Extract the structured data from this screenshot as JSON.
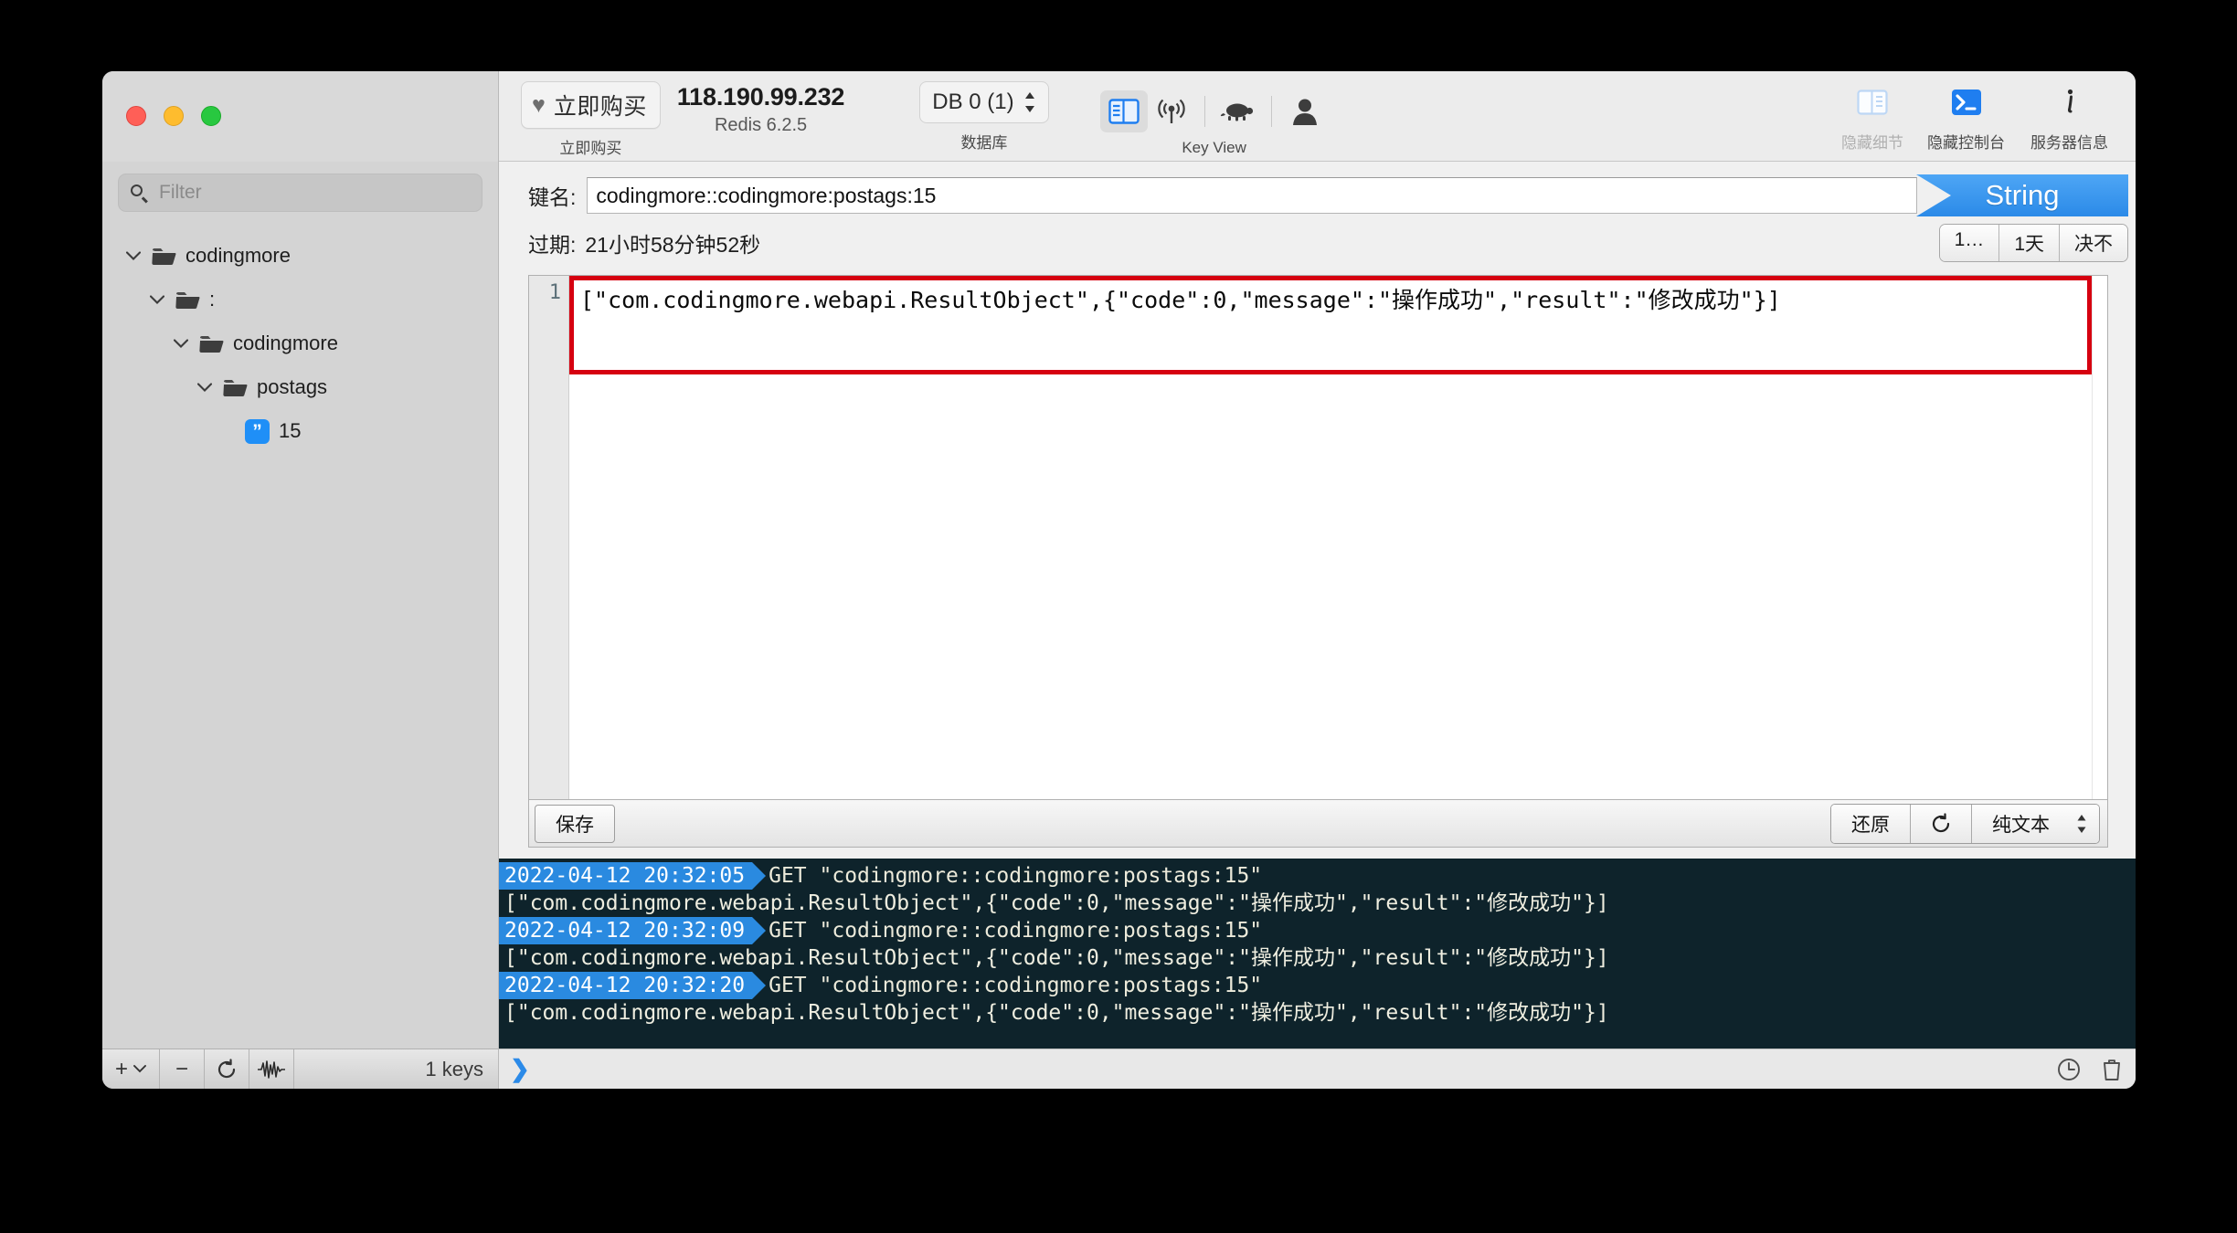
{
  "toolbar": {
    "buy_button_text": "立即购买",
    "buy_button_caption": "立即购买",
    "server_ip": "118.190.99.232",
    "server_version": "Redis 6.2.5",
    "db_selector_value": "DB 0 (1)",
    "db_caption": "数据库",
    "key_view_caption": "Key View",
    "hide_details_label": "隐藏细节",
    "hide_console_label": "隐藏控制台",
    "server_info_label": "服务器信息"
  },
  "sidebar": {
    "filter_placeholder": "Filter",
    "filter_value": "",
    "tree": [
      {
        "label": "codingmore",
        "type": "folder",
        "depth": 0,
        "expanded": true
      },
      {
        "label": ":",
        "type": "folder",
        "depth": 1,
        "expanded": true
      },
      {
        "label": "codingmore",
        "type": "folder",
        "depth": 2,
        "expanded": true
      },
      {
        "label": "postags",
        "type": "folder",
        "depth": 3,
        "expanded": true
      },
      {
        "label": "15",
        "type": "string-key",
        "depth": 4,
        "expanded": false
      }
    ]
  },
  "key_pane": {
    "key_label": "键名:",
    "key_name": "codingmore::codingmore:postags:15",
    "type_badge": "String",
    "expire_label": "过期:",
    "expire_value": "21小时58分钟52秒",
    "ttl_buttons": [
      "1…",
      "1天",
      "决不"
    ],
    "line_number": "1",
    "value": "[\"com.codingmore.webapi.ResultObject\",{\"code\":0,\"message\":\"操作成功\",\"result\":\"修改成功\"}]",
    "save_label": "保存",
    "revert_label": "还原",
    "format_label": "纯文本"
  },
  "console": {
    "entries": [
      {
        "timestamp": "2022-04-12 20:32:05",
        "command": "GET \"codingmore::codingmore:postags:15\"",
        "response": "[\"com.codingmore.webapi.ResultObject\",{\"code\":0,\"message\":\"操作成功\",\"result\":\"修改成功\"}]"
      },
      {
        "timestamp": "2022-04-12 20:32:09",
        "command": "GET \"codingmore::codingmore:postags:15\"",
        "response": "[\"com.codingmore.webapi.ResultObject\",{\"code\":0,\"message\":\"操作成功\",\"result\":\"修改成功\"}]"
      },
      {
        "timestamp": "2022-04-12 20:32:20",
        "command": "GET \"codingmore::codingmore:postags:15\"",
        "response": "[\"com.codingmore.webapi.ResultObject\",{\"code\":0,\"message\":\"操作成功\",\"result\":\"修改成功\"}]"
      }
    ]
  },
  "status_bar": {
    "add_label": "+",
    "remove_label": "−",
    "keys_count": "1 keys",
    "prompt": "❯"
  },
  "colors": {
    "accent_blue": "#2b8ae8",
    "highlight_red": "#d60010",
    "console_bg": "#0e232b",
    "sidebar_bg": "#d4d4d4"
  }
}
